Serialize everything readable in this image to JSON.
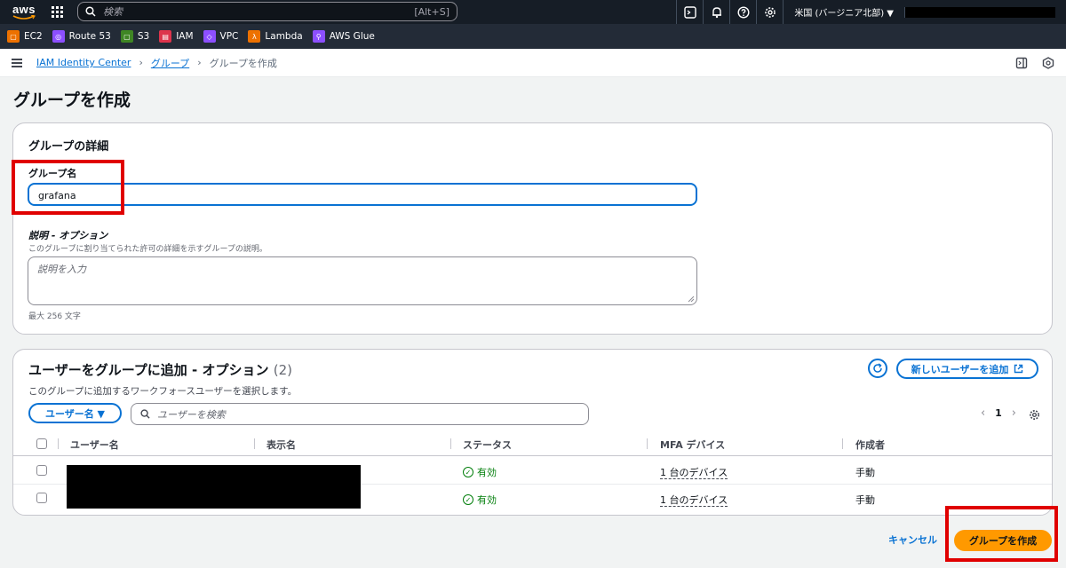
{
  "topnav": {
    "logo": "aws",
    "search_placeholder": "検索",
    "search_shortcut": "[Alt+S]",
    "region": "米国 (バージニア北部) ▼"
  },
  "favorites": [
    {
      "label": "EC2",
      "color": "#ed7100"
    },
    {
      "label": "Route 53",
      "color": "#8c4fff"
    },
    {
      "label": "S3",
      "color": "#3f8624"
    },
    {
      "label": "IAM",
      "color": "#dd344c"
    },
    {
      "label": "VPC",
      "color": "#8c4fff"
    },
    {
      "label": "Lambda",
      "color": "#ed7100"
    },
    {
      "label": "AWS Glue",
      "color": "#8c4fff"
    }
  ],
  "breadcrumb": {
    "root": "IAM Identity Center",
    "groups": "グループ",
    "current": "グループを作成"
  },
  "page_title": "グループを作成",
  "details": {
    "heading": "グループの詳細",
    "name_label": "グループ名",
    "name_value": "grafana",
    "desc_label": "説明 - オプション",
    "desc_hint": "このグループに割り当てられた許可の詳細を示すグループの説明。",
    "desc_placeholder": "説明を入力",
    "desc_constraint": "最大 256 文字"
  },
  "users": {
    "heading": "ユーザーをグループに追加 - オプション",
    "count": "(2)",
    "subtitle": "このグループに追加するワークフォースユーザーを選択します。",
    "new_user_button": "新しいユーザーを追加",
    "filter_button": "ユーザー名 ▼",
    "search_placeholder": "ユーザーを検索",
    "page": "1",
    "columns": [
      "ユーザー名",
      "表示名",
      "ステータス",
      "MFA デバイス",
      "作成者"
    ],
    "rows": [
      {
        "status": "有効",
        "mfa": "1 台のデバイス",
        "creator": "手動"
      },
      {
        "status": "有効",
        "mfa": "1 台のデバイス",
        "creator": "手動"
      }
    ]
  },
  "footer": {
    "cancel": "キャンセル",
    "submit": "グループを作成"
  },
  "colors": {
    "primary": "#ff9900",
    "link": "#0972d3",
    "success": "#037f0c",
    "highlight": "#e00000"
  }
}
